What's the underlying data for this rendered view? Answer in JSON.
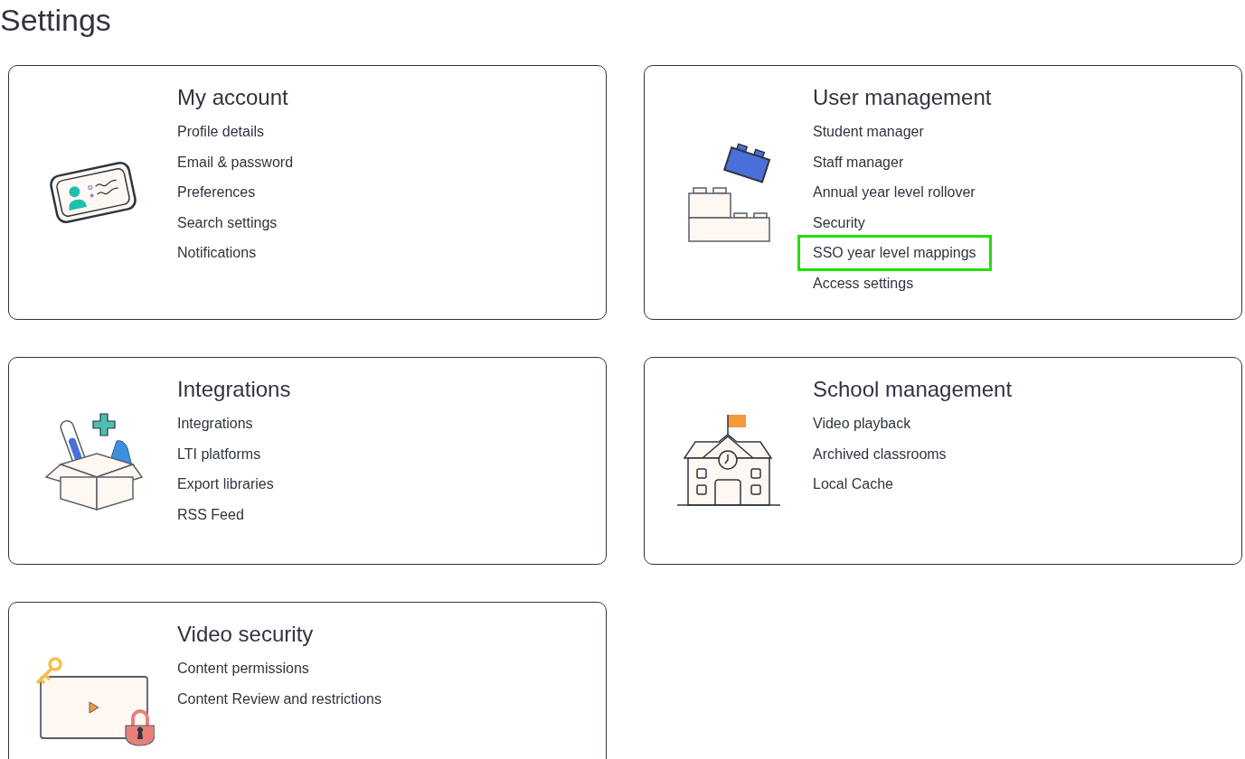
{
  "page_title": "Settings",
  "cards": [
    {
      "kind": "id-card",
      "title": "My account",
      "links": [
        {
          "label": "Profile details",
          "highlighted": false
        },
        {
          "label": "Email & password",
          "highlighted": false
        },
        {
          "label": "Preferences",
          "highlighted": false
        },
        {
          "label": "Search settings",
          "highlighted": false
        },
        {
          "label": "Notifications",
          "highlighted": false
        }
      ]
    },
    {
      "kind": "blocks",
      "title": "User management",
      "links": [
        {
          "label": "Student manager",
          "highlighted": false
        },
        {
          "label": "Staff manager",
          "highlighted": false
        },
        {
          "label": "Annual year level rollover",
          "highlighted": false
        },
        {
          "label": "Security",
          "highlighted": false
        },
        {
          "label": "SSO year level mappings",
          "highlighted": true
        },
        {
          "label": "Access settings",
          "highlighted": false
        }
      ]
    },
    {
      "kind": "box",
      "title": "Integrations",
      "links": [
        {
          "label": "Integrations",
          "highlighted": false
        },
        {
          "label": "LTI platforms",
          "highlighted": false
        },
        {
          "label": "Export libraries",
          "highlighted": false
        },
        {
          "label": "RSS Feed",
          "highlighted": false
        }
      ]
    },
    {
      "kind": "school",
      "title": "School management",
      "links": [
        {
          "label": "Video playback",
          "highlighted": false
        },
        {
          "label": "Archived classrooms",
          "highlighted": false
        },
        {
          "label": "Local Cache",
          "highlighted": false
        }
      ]
    },
    {
      "kind": "video",
      "title": "Video security",
      "links": [
        {
          "label": "Content permissions",
          "highlighted": false
        },
        {
          "label": "Content Review and restrictions",
          "highlighted": false
        }
      ]
    }
  ]
}
